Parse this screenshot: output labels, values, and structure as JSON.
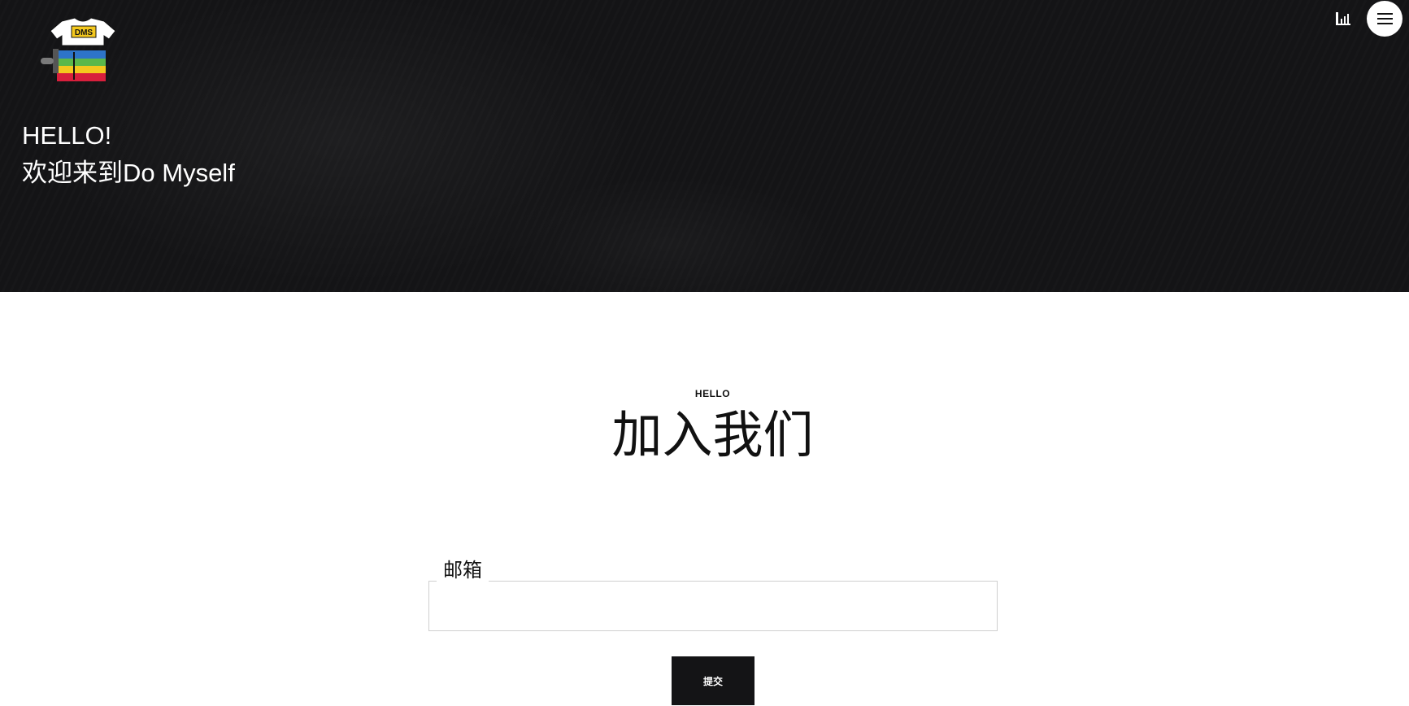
{
  "header": {
    "logo_text": "DMS",
    "greeting": "HELLO!",
    "welcome": "欢迎来到Do Myself",
    "stats_icon": "bar-chart-icon",
    "menu_icon": "hamburger-menu-icon"
  },
  "join_section": {
    "eyebrow": "HELLO",
    "title": "加入我们",
    "email_label": "邮箱",
    "email_value": "",
    "email_placeholder": "",
    "submit_label": "提交"
  },
  "colors": {
    "hero_background": "#141416",
    "text_dark": "#111111",
    "input_border": "#cfcfcf",
    "logo_stripes": [
      "#2d74c9",
      "#5bb84a",
      "#f4c81e",
      "#d81f3c"
    ]
  }
}
